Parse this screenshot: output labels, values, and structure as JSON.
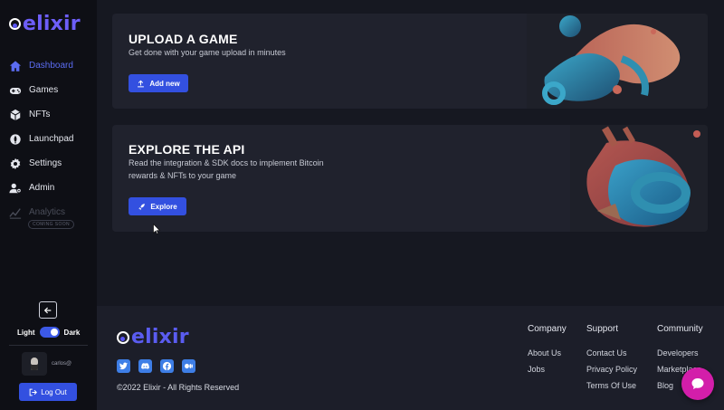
{
  "brand": {
    "name": "elixir",
    "accent": "#5b6cf2",
    "button_color": "#3350e0"
  },
  "sidebar": {
    "items": [
      {
        "label": "Dashboard",
        "icon": "home-icon",
        "active": true
      },
      {
        "label": "Games",
        "icon": "gamepad-icon"
      },
      {
        "label": "NFTs",
        "icon": "nft-cube-icon"
      },
      {
        "label": "Launchpad",
        "icon": "rocket-icon"
      },
      {
        "label": "Settings",
        "icon": "gear-icon"
      },
      {
        "label": "Admin",
        "icon": "user-admin-icon"
      },
      {
        "label": "Analytics",
        "icon": "chart-icon",
        "disabled": true
      }
    ],
    "coming_soon": "COMING SOON",
    "theme_light": "Light",
    "theme_dark": "Dark",
    "theme_selected": "Dark",
    "username": "carlos@",
    "logout_label": "Log Out"
  },
  "cards": [
    {
      "title": "UPLOAD A GAME",
      "desc": "Get done with your game upload in minutes",
      "button": "Add new",
      "button_icon": "upload-icon"
    },
    {
      "title": "EXPLORE THE API",
      "desc_line1": "Read the integration & SDK docs to implement Bitcoin",
      "desc_line2": "rewards & NFTs to your game",
      "button": "Explore",
      "button_icon": "rocket-icon"
    }
  ],
  "footer": {
    "socials": [
      "twitter-icon",
      "discord-icon",
      "facebook-icon",
      "medium-icon"
    ],
    "copyright": "©2022 Elixir - All Rights Reserved",
    "columns": [
      {
        "heading": "Company",
        "links": [
          "About Us",
          "Jobs"
        ]
      },
      {
        "heading": "Support",
        "links": [
          "Contact Us",
          "Privacy Policy",
          "Terms Of Use"
        ]
      },
      {
        "heading": "Community",
        "links": [
          "Developers",
          "Marketplace",
          "Blog"
        ]
      }
    ]
  },
  "chat": {
    "icon": "chat-bubble-icon",
    "color": "#d31eaa"
  }
}
